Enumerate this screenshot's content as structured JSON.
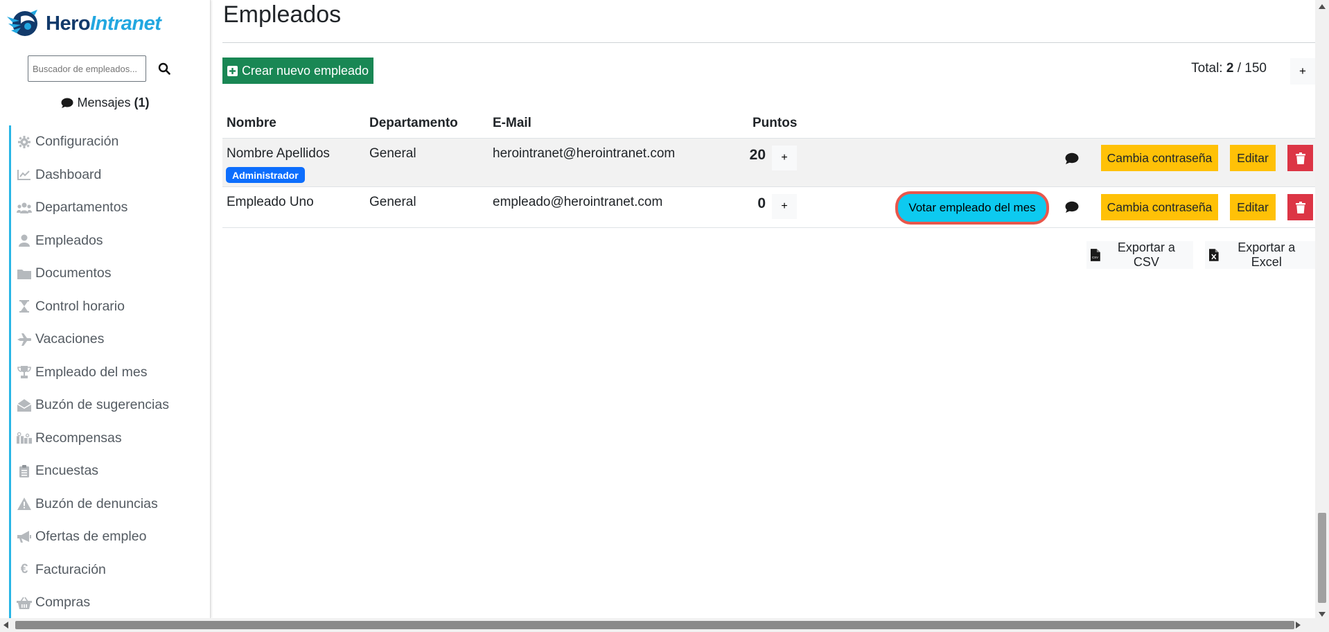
{
  "brand": {
    "part1": "Hero",
    "part2": "Intranet"
  },
  "search": {
    "placeholder": "Buscador de empleados..."
  },
  "messages": {
    "label": "Mensajes",
    "count": "(1)"
  },
  "nav": [
    {
      "label": "Configuración",
      "icon": "gear-icon"
    },
    {
      "label": "Dashboard",
      "icon": "chart-line-icon"
    },
    {
      "label": "Departamentos",
      "icon": "users-icon"
    },
    {
      "label": "Empleados",
      "icon": "user-icon"
    },
    {
      "label": "Documentos",
      "icon": "folder-icon"
    },
    {
      "label": "Control horario",
      "icon": "hourglass-icon"
    },
    {
      "label": "Vacaciones",
      "icon": "plane-icon"
    },
    {
      "label": "Empleado del mes",
      "icon": "trophy-icon"
    },
    {
      "label": "Buzón de sugerencias",
      "icon": "envelope-open-icon"
    },
    {
      "label": "Recompensas",
      "icon": "gifts-icon"
    },
    {
      "label": "Encuestas",
      "icon": "clipboard-list-icon"
    },
    {
      "label": "Buzón de denuncias",
      "icon": "warning-icon"
    },
    {
      "label": "Ofertas de empleo",
      "icon": "megaphone-icon"
    },
    {
      "label": "Facturación",
      "icon": "euro-icon"
    },
    {
      "label": "Compras",
      "icon": "basket-icon"
    }
  ],
  "page": {
    "title": "Empleados",
    "create_label": "Crear nuevo empleado",
    "total_prefix": "Total:",
    "total_current": "2",
    "total_sep": "/ 150",
    "add_label": "+"
  },
  "table": {
    "headers": {
      "name": "Nombre",
      "department": "Departamento",
      "email": "E-Mail",
      "points": "Puntos"
    },
    "rows": [
      {
        "name": "Nombre Apellidos",
        "badge": "Administrador",
        "department": "General",
        "email": "herointranet@herointranet.com",
        "points": "20",
        "inc": "+",
        "password": "Cambia contraseña",
        "edit": "Editar"
      },
      {
        "name": "Empleado Uno",
        "department": "General",
        "email": "empleado@herointranet.com",
        "points": "0",
        "inc": "+",
        "vote": "Votar empleado del mes",
        "password": "Cambia contraseña",
        "edit": "Editar"
      }
    ]
  },
  "export": {
    "csv": "Exportar a CSV",
    "excel": "Exportar a Excel"
  },
  "colors": {
    "accent_green": "#198754",
    "sidebar_border": "#29b6e6",
    "warning": "#ffc107",
    "danger": "#dc3545",
    "info": "#0dcaf0",
    "badge": "#0d6efd"
  }
}
